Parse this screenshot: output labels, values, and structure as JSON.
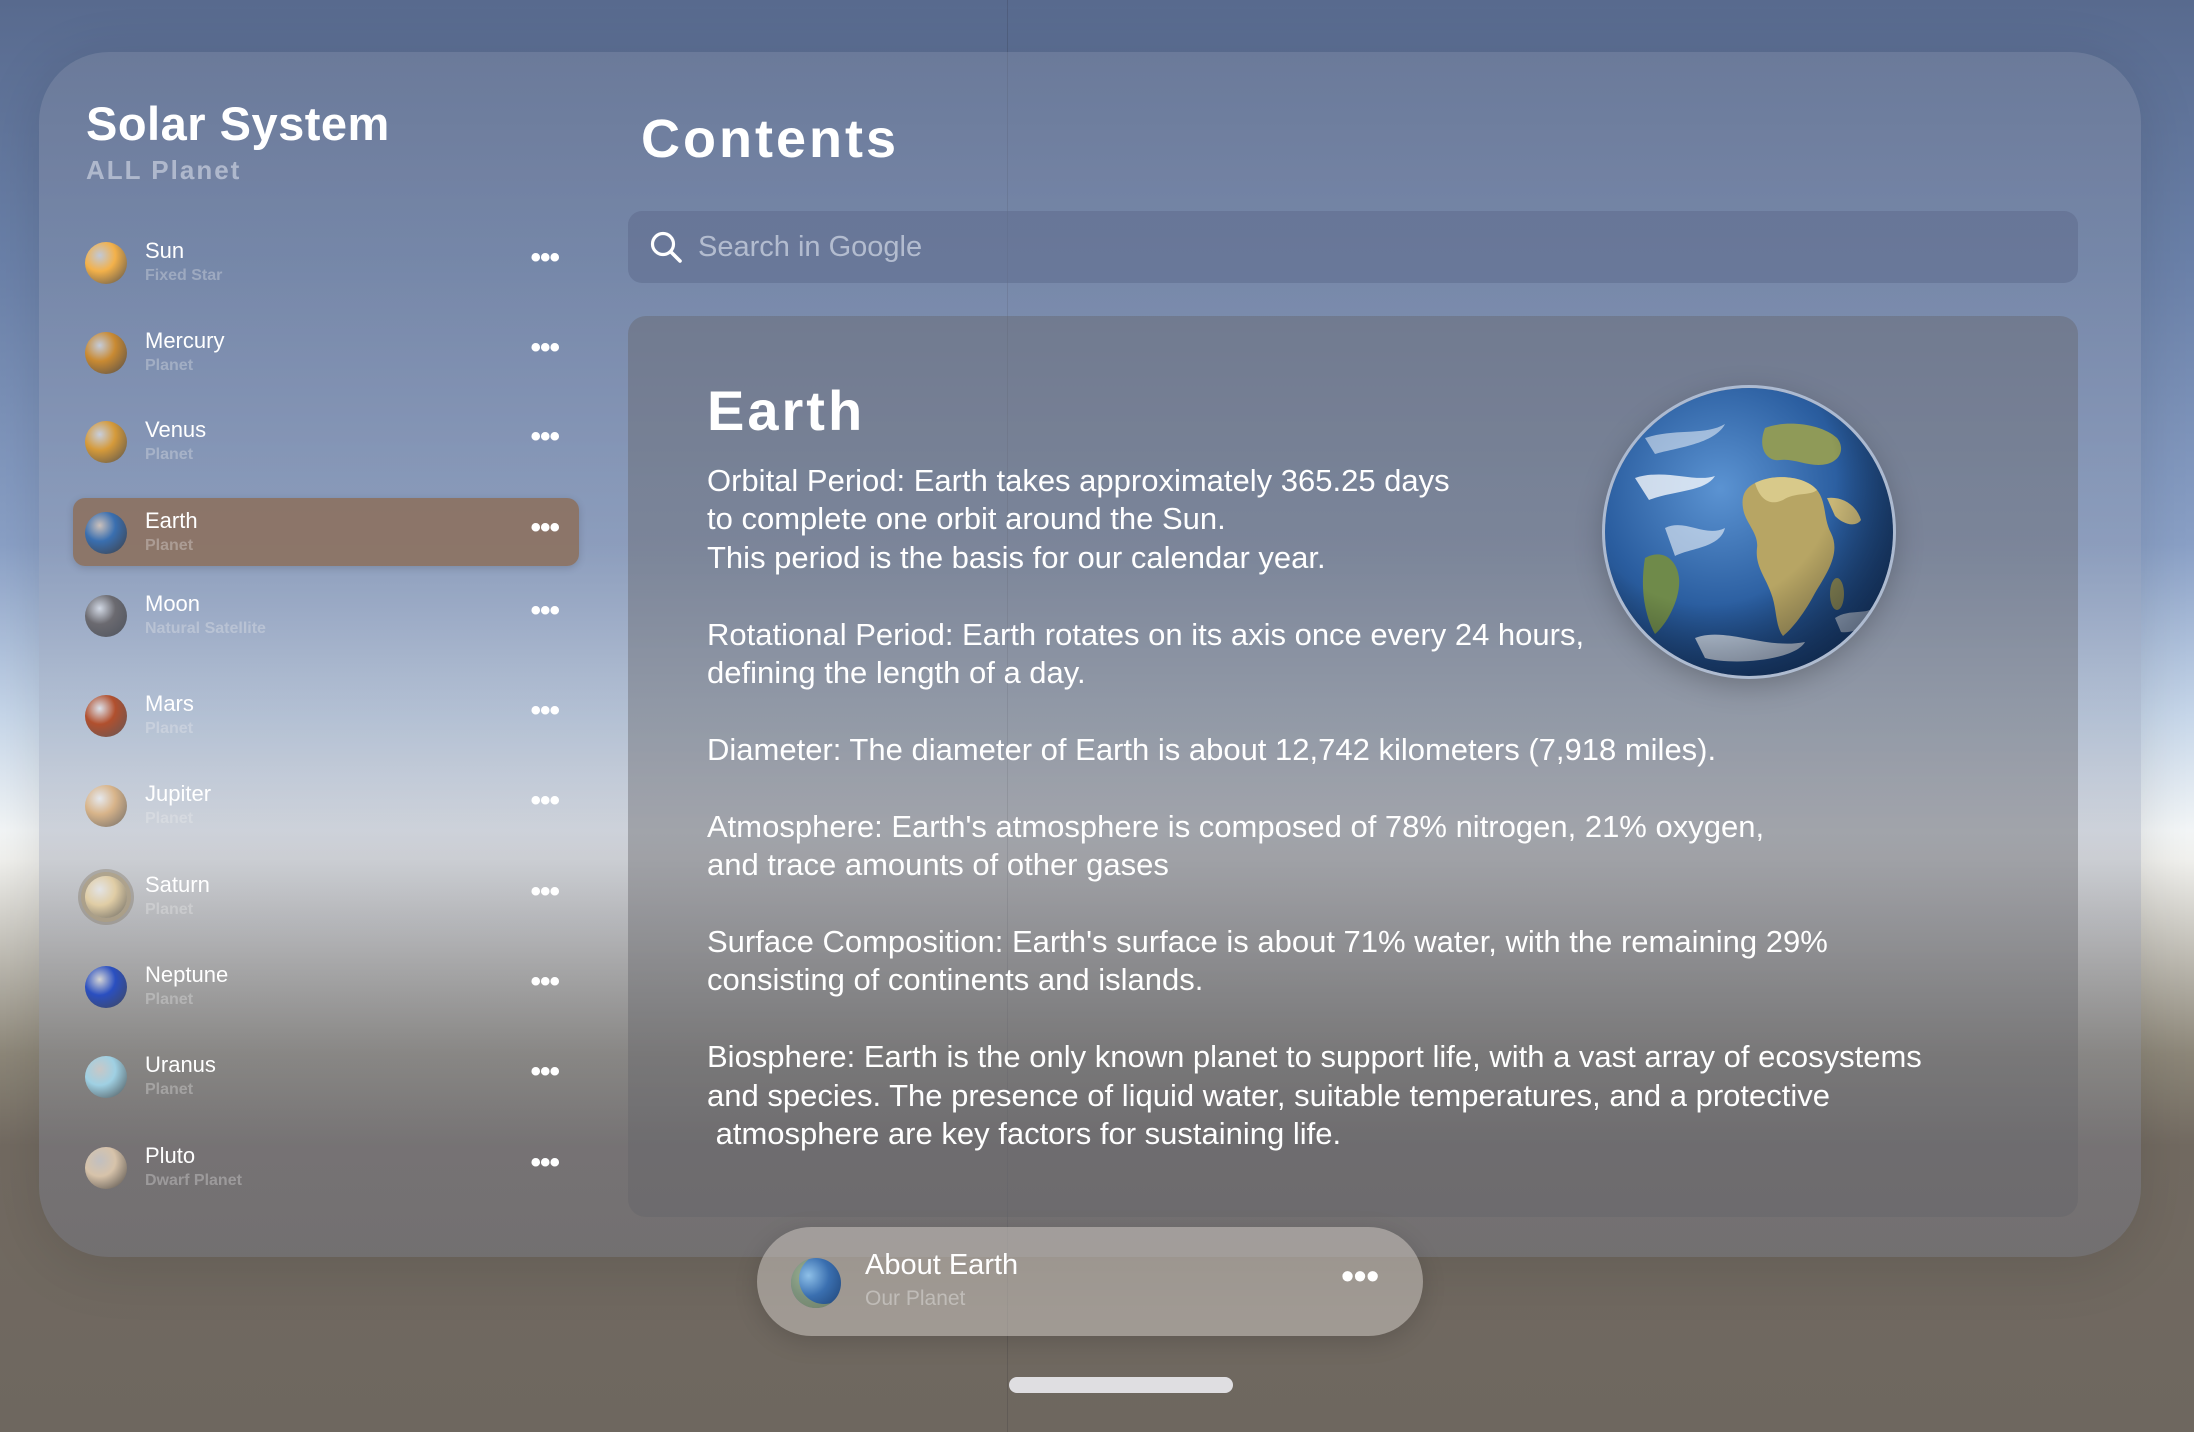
{
  "sidebar": {
    "title": "Solar System",
    "subtitle": "ALL Planet",
    "items": [
      {
        "name": "Sun",
        "kind": "Fixed Star",
        "icon": "sun-icon",
        "color": "#f3b14a"
      },
      {
        "name": "Mercury",
        "kind": "Planet",
        "icon": "mercury-icon",
        "color": "#c98a32"
      },
      {
        "name": "Venus",
        "kind": "Planet",
        "icon": "venus-icon",
        "color": "#d59a3a"
      },
      {
        "name": "Earth",
        "kind": "Planet",
        "icon": "earth-icon",
        "color": "#3a6fb0",
        "selected": true
      },
      {
        "name": "Moon",
        "kind": "Natural Satellite",
        "icon": "moon-icon",
        "color": "#6b6a70"
      },
      {
        "name": "Mars",
        "kind": "Planet",
        "icon": "mars-icon",
        "color": "#b1502e"
      },
      {
        "name": "Jupiter",
        "kind": "Planet",
        "icon": "jupiter-icon",
        "color": "#d8b48a"
      },
      {
        "name": "Saturn",
        "kind": "Planet",
        "icon": "saturn-icon",
        "color": "#e0cda5"
      },
      {
        "name": "Neptune",
        "kind": "Planet",
        "icon": "neptune-icon",
        "color": "#2a4fc0"
      },
      {
        "name": "Uranus",
        "kind": "Planet",
        "icon": "uranus-icon",
        "color": "#9fd0e3"
      },
      {
        "name": "Pluto",
        "kind": "Dwarf Planet",
        "icon": "pluto-icon",
        "color": "#d7c3aa"
      }
    ],
    "more_glyph": "•••"
  },
  "main": {
    "title": "Contents",
    "search": {
      "placeholder": "Search in Google",
      "icon": "search-icon"
    },
    "article": {
      "title": "Earth",
      "body": "Orbital Period: Earth takes approximately 365.25 days\nto complete one orbit around the Sun.\nThis period is the basis for our calendar year.\n\nRotational Period: Earth rotates on its axis once every 24 hours,\ndefining the length of a day.\n\nDiameter: The diameter of Earth is about 12,742 kilometers (7,918 miles).\n\nAtmosphere: Earth's atmosphere is composed of 78% nitrogen, 21% oxygen,\nand trace amounts of other gases\n\nSurface Composition: Earth's surface is about 71% water, with the remaining 29%\nconsisting of continents and islands.\n\nBiosphere: Earth is the only known planet to support life, with a vast array of ecosystems\nand species. The presence of liquid water, suitable temperatures, and a protective\n atmosphere are key factors for sustaining life.",
      "image": "earth-globe-image"
    }
  },
  "now_playing": {
    "title": "About Earth",
    "subtitle": "Our Planet",
    "icon": "earth-icon",
    "more_glyph": "•••"
  },
  "colors": {
    "selected_row": "#8c6e5a",
    "ocean": "#2f63a8",
    "land": "#b9b36a"
  }
}
